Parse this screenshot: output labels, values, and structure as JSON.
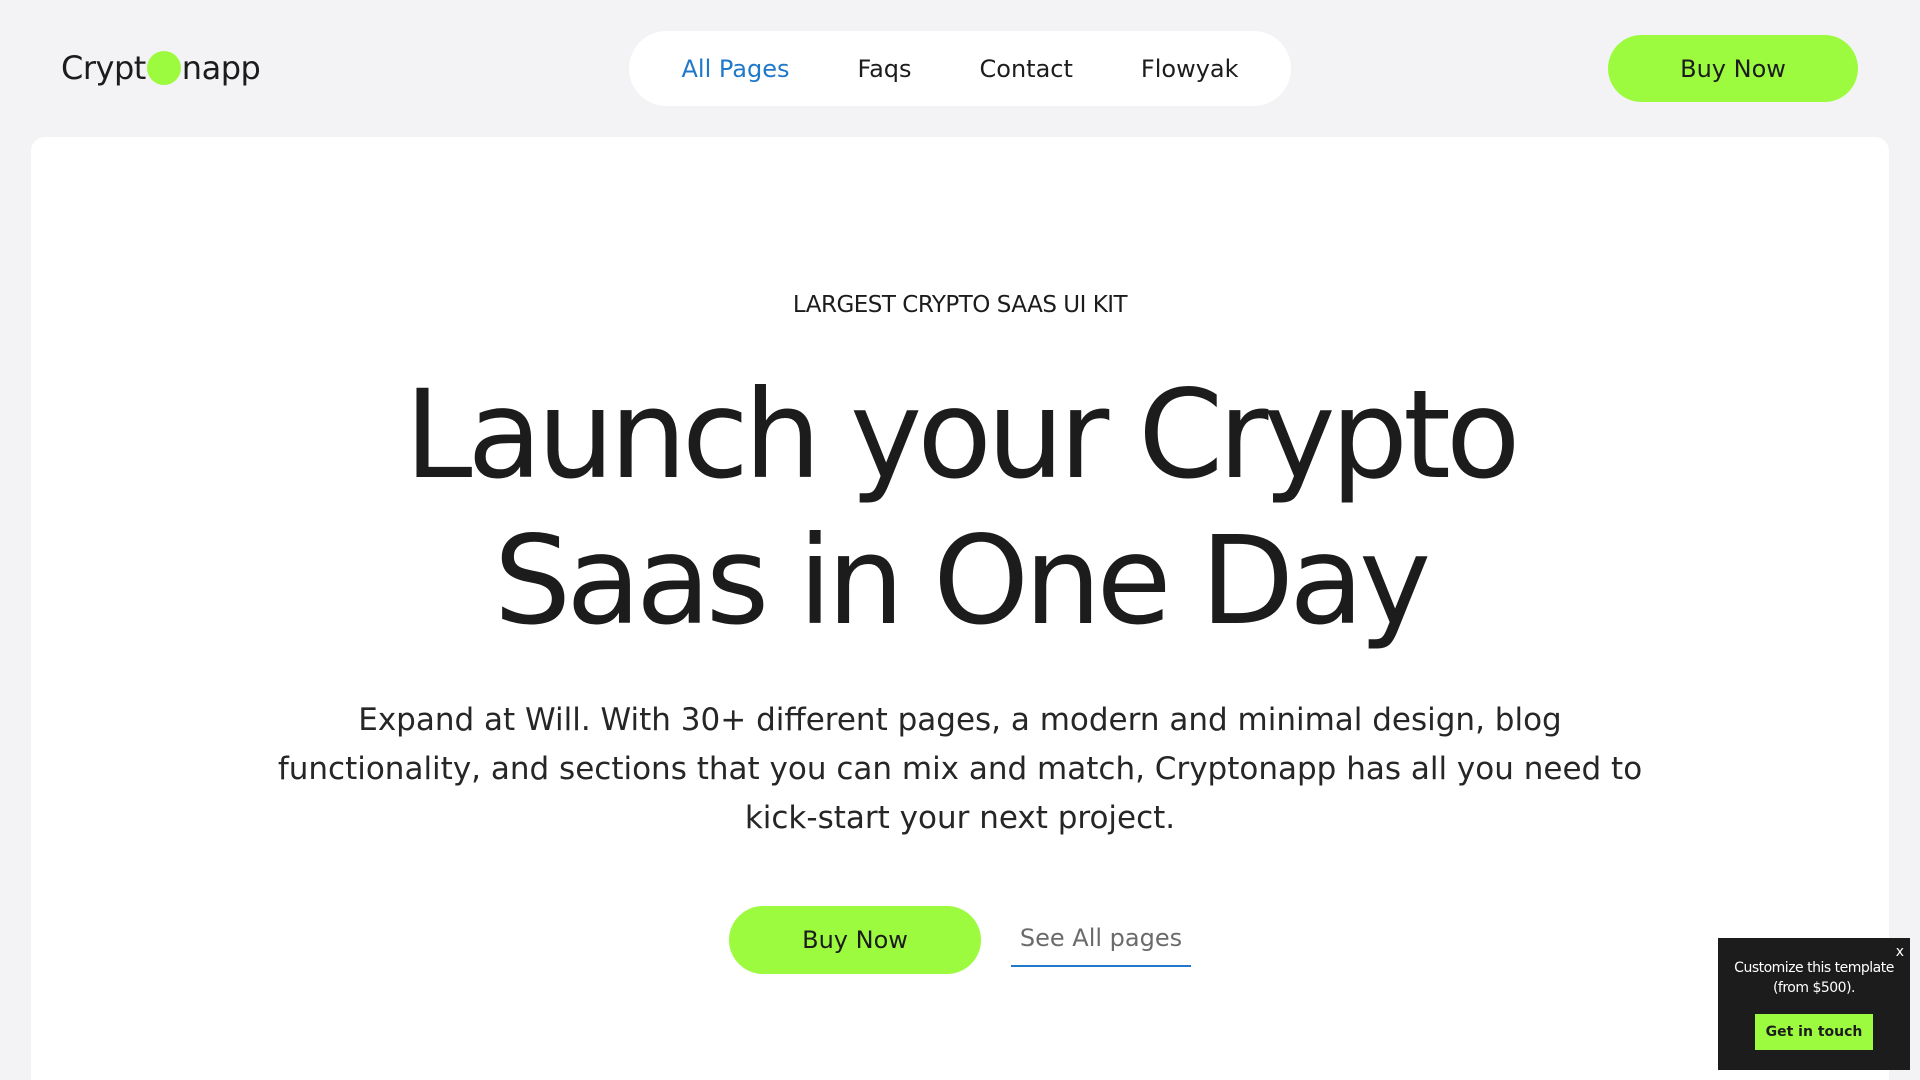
{
  "header": {
    "logo": {
      "left": "Crypt",
      "right": "napp"
    },
    "nav": [
      {
        "label": "All Pages",
        "active": true
      },
      {
        "label": "Faqs",
        "active": false
      },
      {
        "label": "Contact",
        "active": false
      },
      {
        "label": "Flowyak",
        "active": false
      }
    ],
    "buy_label": "Buy Now"
  },
  "hero": {
    "eyebrow": "LARGEST CRYPTO SAAS UI KIT",
    "headline_line1": "Launch your Crypto",
    "headline_line2": "Saas in One Day",
    "description": "Expand at Will. With 30+ different pages, a modern and minimal design, blog functionality, and sections that you can mix and match, Cryptonapp has all you need to kick-start your next project.",
    "primary_cta": "Buy Now",
    "secondary_cta": "See All pages"
  },
  "popup": {
    "close": "x",
    "text_line1": "Customize this template",
    "text_line2": "(from $500).",
    "button": "Get in touch"
  },
  "colors": {
    "accent": "#9dfb3f",
    "link": "#1f78c9",
    "background": "#f3f3f5",
    "text": "#1c1c1c"
  }
}
